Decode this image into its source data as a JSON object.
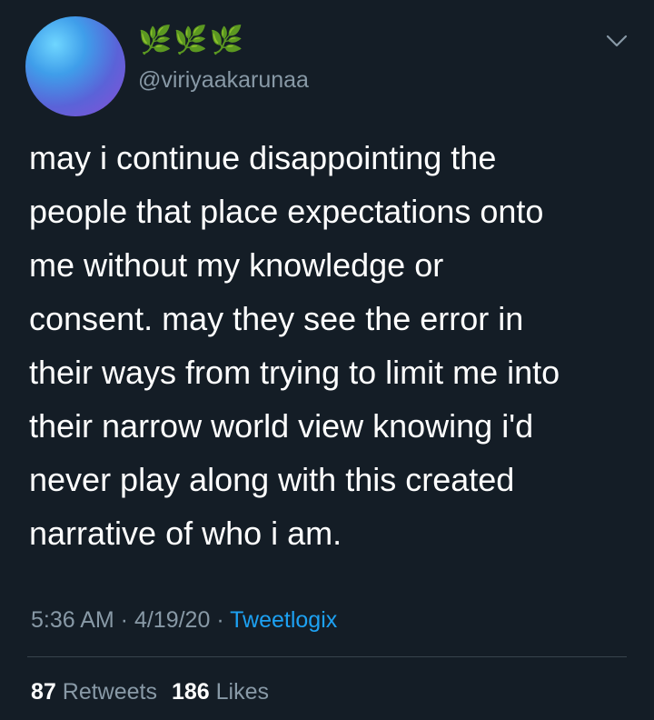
{
  "author": {
    "display_name": "🌿🌿🌿",
    "handle": "@viriyaakarunaa",
    "avatar_colors": [
      "#6fd6ff",
      "#3f9eea",
      "#5a63d8",
      "#8a4fd8"
    ]
  },
  "icons": {
    "menu": "chevron-down-icon",
    "display_name_glyph": "herb-icon"
  },
  "tweet": {
    "lines": [
      "may i continue disappointing the",
      "people that place expectations onto",
      "me without my knowledge or",
      "consent. may they see the error in",
      "their ways from trying to limit me into",
      "their narrow world view knowing i'd",
      "never play along with this created",
      "narrative of who i am."
    ]
  },
  "meta": {
    "time": "5:36 AM",
    "separator": " · ",
    "date": "4/19/20",
    "source": "Tweetlogix"
  },
  "stats": {
    "retweets_count": "87",
    "retweets_label": "Retweets",
    "likes_count": "186",
    "likes_label": "Likes"
  },
  "colors": {
    "background": "#141d26",
    "text": "#ffffff",
    "secondary": "#8899a6",
    "link": "#1da1f2",
    "leaf": "#5cc56a"
  }
}
